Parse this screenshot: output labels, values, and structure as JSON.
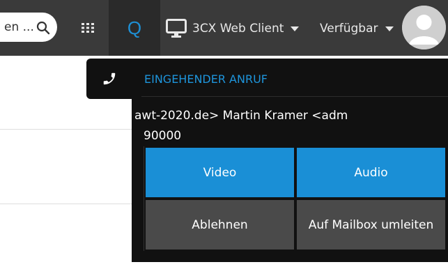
{
  "topbar": {
    "search_placeholder": "en ...",
    "q_label": "Q",
    "client_label": "3CX Web Client",
    "status_label": "Verfügbar"
  },
  "call": {
    "title": "EINGEHENDER ANRUF",
    "caller": "awt-2020.de> Martin Kramer <adm",
    "number": "90000",
    "buttons": {
      "video": "Video",
      "audio": "Audio",
      "decline": "Ablehnen",
      "voicemail": "Auf Mailbox umleiten"
    }
  },
  "colors": {
    "accent": "#1a8fd6",
    "topbar": "#3a3a3a",
    "panel": "#111111"
  }
}
